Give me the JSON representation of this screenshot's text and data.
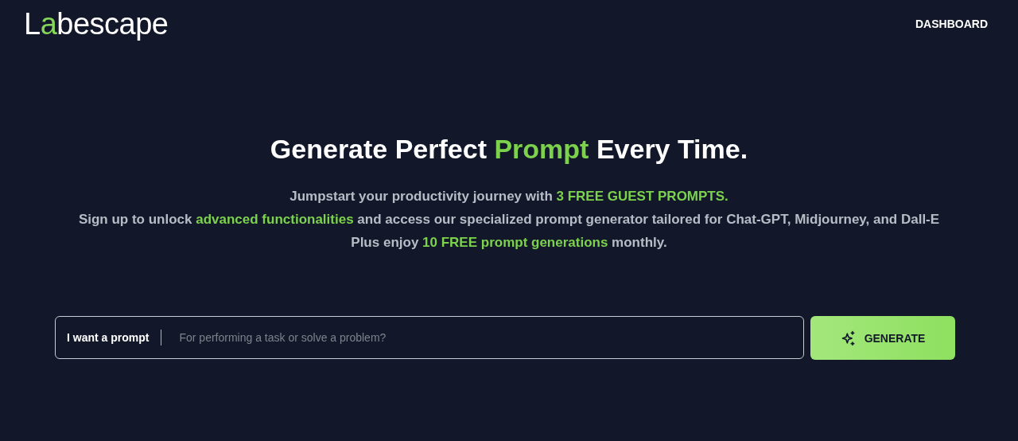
{
  "header": {
    "logo": "Labescape",
    "nav": [
      {
        "label": "DASHBOARD"
      }
    ]
  },
  "hero": {
    "heading": [
      {
        "text": "Generate Perfect ",
        "highlight": false
      },
      {
        "text": "Prompt",
        "highlight": true
      },
      {
        "text": " Every Time.",
        "highlight": false
      }
    ],
    "lines": [
      [
        {
          "text": "Jumpstart your productivity journey with ",
          "highlight": false
        },
        {
          "text": "3 FREE GUEST PROMPTS.",
          "highlight": true
        }
      ],
      [
        {
          "text": "Sign up to unlock ",
          "highlight": false
        },
        {
          "text": "advanced functionalities",
          "highlight": true
        },
        {
          "text": " and access our specialized prompt generator tailored for Chat-GPT, Midjourney, and Dall-E",
          "highlight": false
        }
      ],
      [
        {
          "text": "Plus enjoy ",
          "highlight": false
        },
        {
          "text": "10 FREE prompt generations",
          "highlight": true
        },
        {
          "text": " monthly.",
          "highlight": false
        }
      ]
    ]
  },
  "prompt_form": {
    "label": "I want a prompt",
    "placeholder": "For performing a task or solve a problem?",
    "button": "GENERATE"
  }
}
